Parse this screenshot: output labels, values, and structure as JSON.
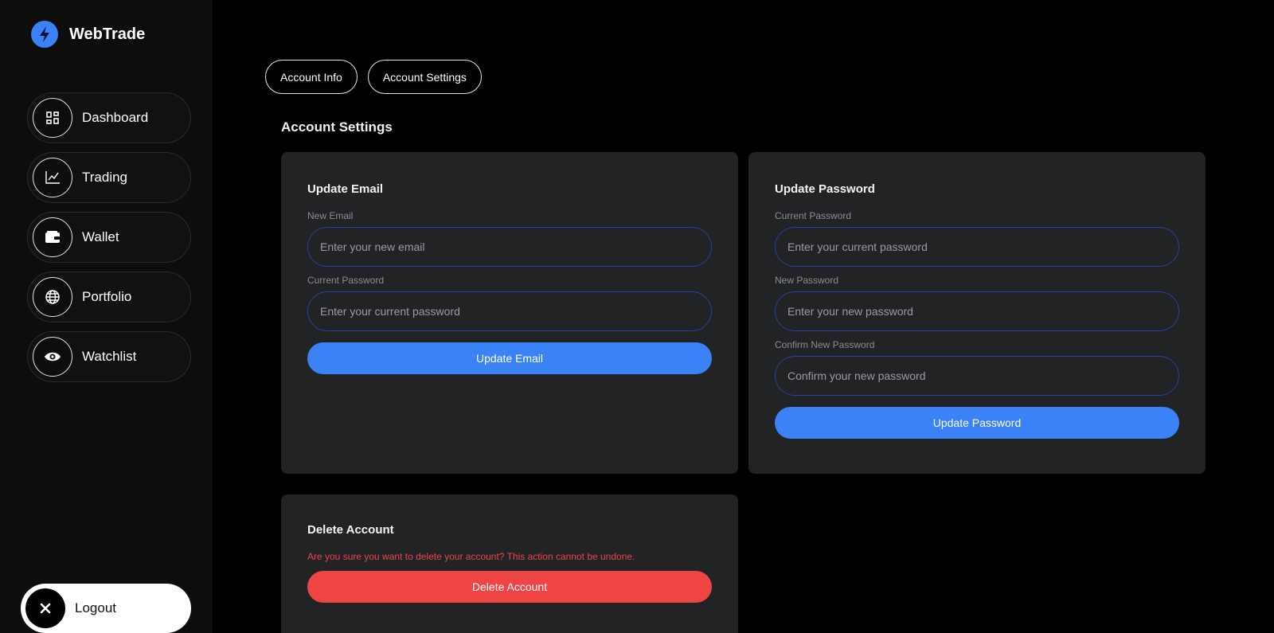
{
  "brand": {
    "name": "WebTrade",
    "logo_icon": "lightning-bolt-icon",
    "accent": "#3b82f6"
  },
  "sidebar": {
    "items": [
      {
        "label": "Dashboard",
        "icon": "dashboard-grid-icon"
      },
      {
        "label": "Trading",
        "icon": "line-chart-icon"
      },
      {
        "label": "Wallet",
        "icon": "wallet-icon"
      },
      {
        "label": "Portfolio",
        "icon": "globe-icon"
      },
      {
        "label": "Watchlist",
        "icon": "eye-icon"
      }
    ],
    "logout": {
      "label": "Logout",
      "icon": "close-icon"
    }
  },
  "tabs": [
    {
      "label": "Account Info"
    },
    {
      "label": "Account Settings"
    }
  ],
  "page_title": "Account Settings",
  "email_card": {
    "title": "Update Email",
    "new_email_label": "New Email",
    "new_email_placeholder": "Enter your new email",
    "current_password_label": "Current Password",
    "current_password_placeholder": "Enter your current password",
    "button_label": "Update Email"
  },
  "password_card": {
    "title": "Update Password",
    "current_password_label": "Current Password",
    "current_password_placeholder": "Enter your current password",
    "new_password_label": "New Password",
    "new_password_placeholder": "Enter your new password",
    "confirm_password_label": "Confirm New Password",
    "confirm_password_placeholder": "Confirm your new password",
    "button_label": "Update Password"
  },
  "delete_card": {
    "title": "Delete Account",
    "warning": "Are you sure you want to delete your account? This action cannot be undone.",
    "button_label": "Delete Account",
    "danger_color": "#ef4444"
  }
}
